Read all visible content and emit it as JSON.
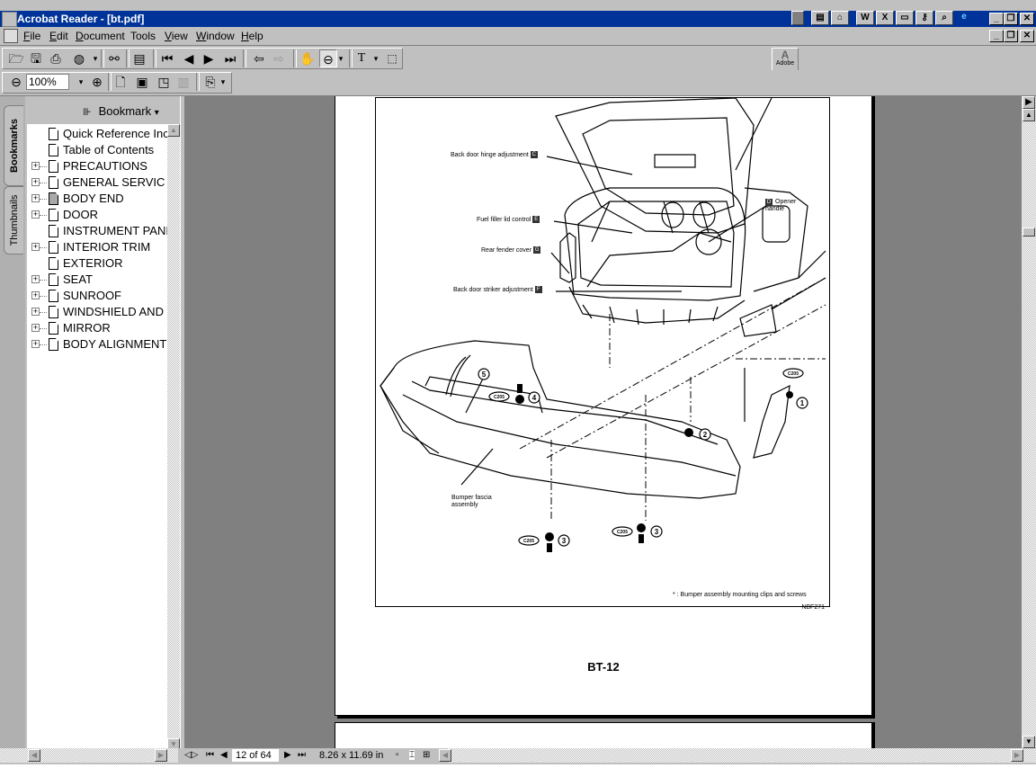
{
  "window": {
    "title": "Acrobat Reader - [bt.pdf]",
    "tray_icons": [
      "office-shortcut-icon",
      "new-document-icon",
      "open-folder-icon",
      "word-icon",
      "excel-icon",
      "powerpoint-icon",
      "key-icon",
      "find-icon",
      "internet-explorer-icon"
    ],
    "tray_letters": {
      "word": "W",
      "excel": "X"
    }
  },
  "menu": {
    "items": [
      {
        "label": "File",
        "accel": "F"
      },
      {
        "label": "Edit",
        "accel": "E"
      },
      {
        "label": "Document",
        "accel": "D"
      },
      {
        "label": "Tools",
        "accel": ""
      },
      {
        "label": "View",
        "accel": "V"
      },
      {
        "label": "Window",
        "accel": "W"
      },
      {
        "label": "Help",
        "accel": "H"
      }
    ]
  },
  "toolbar": {
    "zoom_value": "100%",
    "adobe_label": "Adobe"
  },
  "nav_panel": {
    "tabs": [
      "Bookmarks",
      "Thumbnails"
    ],
    "active_tab": "Bookmarks",
    "header_label": "Bookmark",
    "bookmarks": [
      {
        "label": "Quick Reference Inc",
        "expandable": false,
        "selected": false
      },
      {
        "label": "Table of Contents",
        "expandable": false,
        "selected": false
      },
      {
        "label": "PRECAUTIONS",
        "expandable": true,
        "selected": false
      },
      {
        "label": "GENERAL SERVIC",
        "expandable": true,
        "selected": false
      },
      {
        "label": "BODY END",
        "expandable": true,
        "selected": true
      },
      {
        "label": "DOOR",
        "expandable": true,
        "selected": false
      },
      {
        "label": "INSTRUMENT PANI",
        "expandable": false,
        "selected": false
      },
      {
        "label": "INTERIOR TRIM",
        "expandable": true,
        "selected": false
      },
      {
        "label": "EXTERIOR",
        "expandable": false,
        "selected": false
      },
      {
        "label": "SEAT",
        "expandable": true,
        "selected": false
      },
      {
        "label": "SUNROOF",
        "expandable": true,
        "selected": false
      },
      {
        "label": "WINDSHIELD AND",
        "expandable": true,
        "selected": false
      },
      {
        "label": "MIRROR",
        "expandable": true,
        "selected": false
      },
      {
        "label": "BODY ALIGNMENT",
        "expandable": true,
        "selected": false
      }
    ]
  },
  "document": {
    "page_label": "BT-12",
    "figure": {
      "callouts": [
        {
          "text": "Back door hinge adjustment",
          "key": "C"
        },
        {
          "text": "Fuel filler lid control",
          "key": "E"
        },
        {
          "text": "Rear fender cover",
          "key": "G"
        },
        {
          "text": "Back door striker adjustment",
          "key": "F"
        },
        {
          "text": "Opener handle",
          "key": "D"
        }
      ],
      "part_numbers": [
        "1",
        "2",
        "3",
        "3",
        "4",
        "5"
      ],
      "clip_code": "C205",
      "part_label": "Bumper fascia assembly",
      "footnote": "* : Bumper assembly mounting clips and screws",
      "figure_id": "NBF271"
    }
  },
  "statusbar": {
    "page_indicator": "12 of 64",
    "page_size": "8.26 x 11.69 in"
  }
}
